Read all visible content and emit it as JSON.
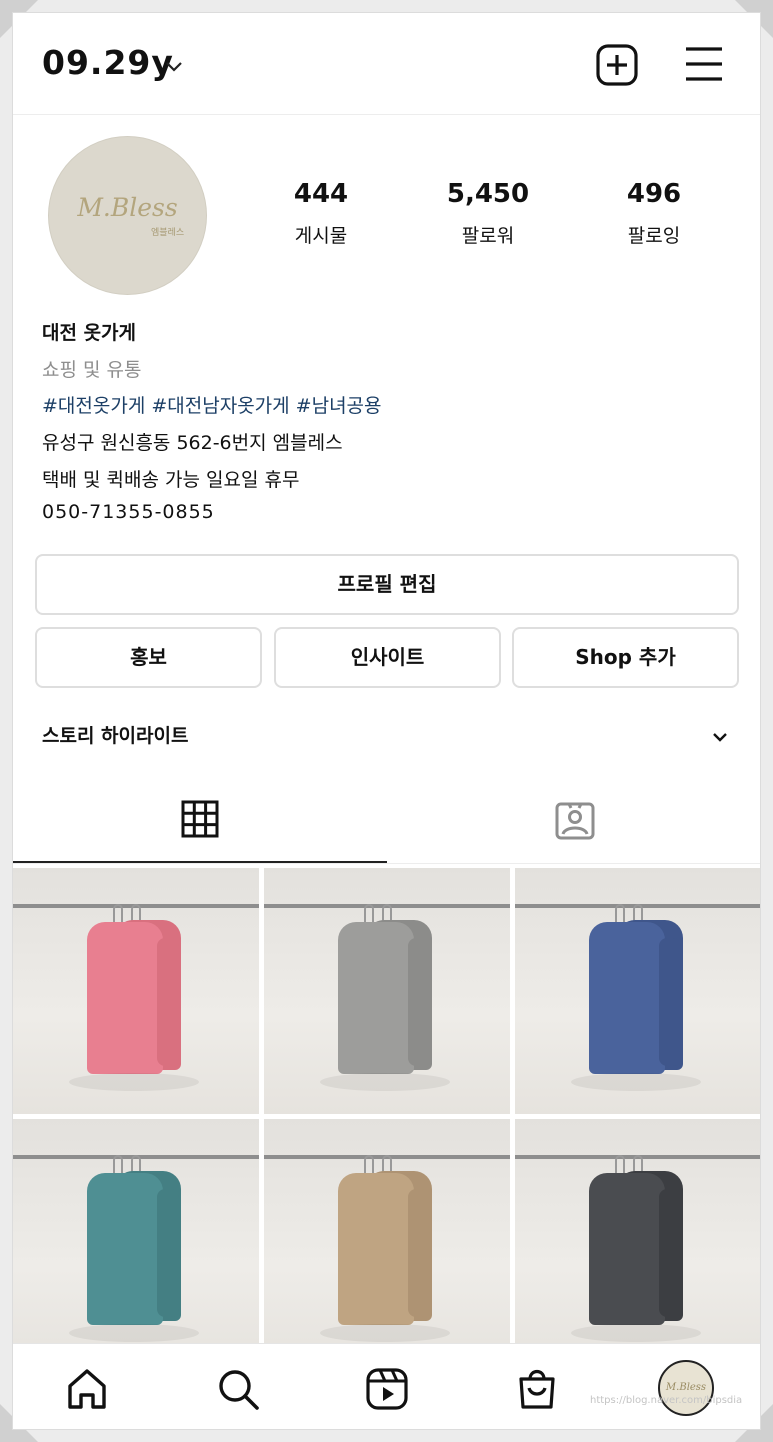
{
  "header": {
    "username": "09.29y",
    "chevron_icon": "chevron-down-icon",
    "new_post_icon": "plus-square-icon",
    "menu_icon": "hamburger-menu-icon"
  },
  "profile": {
    "avatar_logo": "M.Bless",
    "avatar_sub": "엠블레스",
    "stats": [
      {
        "value": "444",
        "label": "게시물"
      },
      {
        "value": "5,450",
        "label": "팔로워"
      },
      {
        "value": "496",
        "label": "팔로잉"
      }
    ]
  },
  "bio": {
    "name": "대전 옷가게",
    "category": "쇼핑 및 유통",
    "hashtags": "#대전옷가게 #대전남자옷가게 #남녀공용",
    "line1": "유성구 원신흥동 562-6번지 엠블레스",
    "line2": "택배 및 퀵배송 가능 일요일 휴무",
    "phone": "050-71355-0855"
  },
  "buttons": {
    "edit_profile": "프로필 편집",
    "promote": "홍보",
    "insights": "인사이트",
    "add_shop": "Shop 추가"
  },
  "highlights": {
    "label": "스토리 하이라이트"
  },
  "tabs": {
    "grid_icon": "grid-icon",
    "tagged_icon": "tagged-person-icon",
    "active": "grid"
  },
  "posts": [
    {
      "color": "#e87f90",
      "back": "#d9707f"
    },
    {
      "color": "#9d9d9b",
      "back": "#8c8c8a"
    },
    {
      "color": "#4a639c",
      "back": "#3f568b"
    },
    {
      "color": "#4f8f93",
      "back": "#447f83"
    },
    {
      "color": "#bfa482",
      "back": "#ae9373"
    },
    {
      "color": "#4a4c50",
      "back": "#3c3e42"
    }
  ],
  "bottom_nav": {
    "items": [
      "home-icon",
      "search-icon",
      "reels-icon",
      "shop-bag-icon",
      "profile-avatar"
    ],
    "avatar_text": "M.Bless"
  },
  "watermark": "https://blog.naver.com/bipsdia"
}
